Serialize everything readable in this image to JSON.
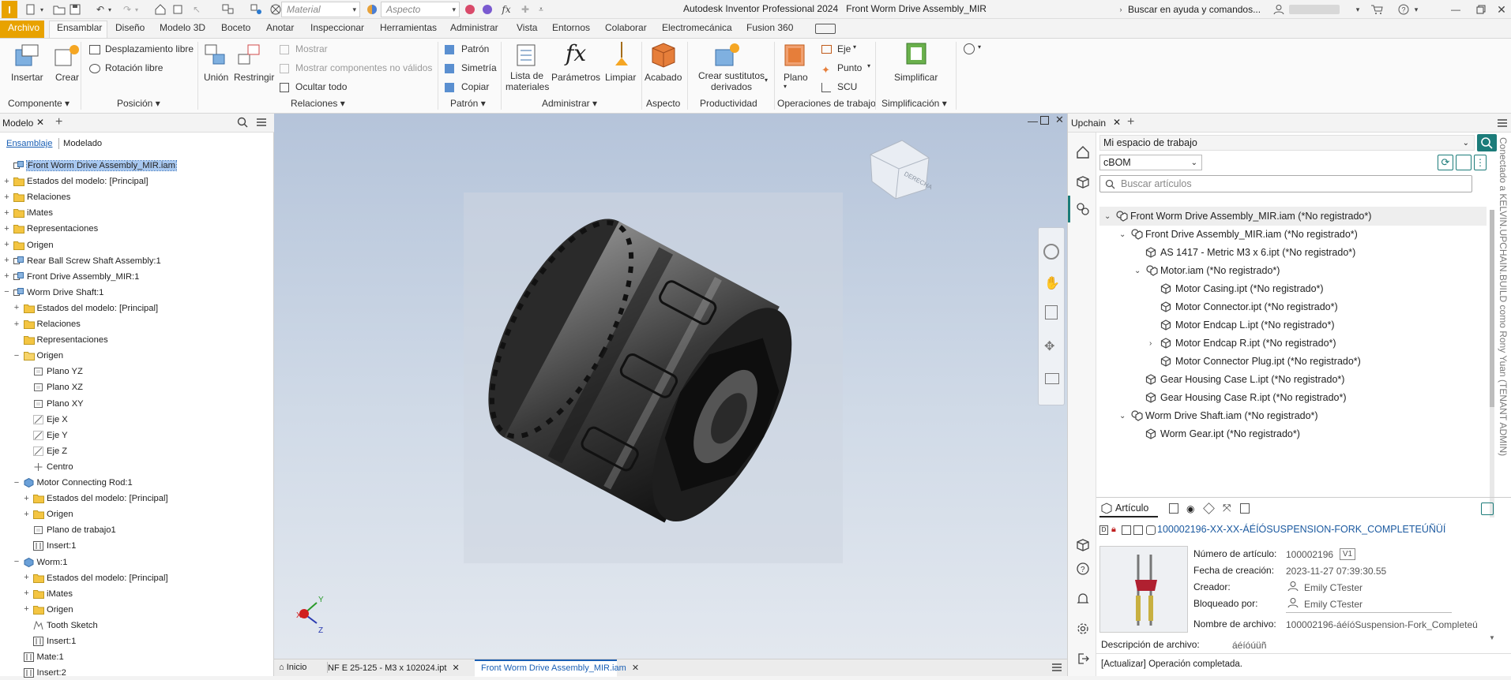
{
  "title_bar": {
    "app_title": "Autodesk Inventor Professional 2024",
    "doc_title": "Front Worm Drive Assembly_MIR",
    "material_placeholder": "Material",
    "appearance_placeholder": "Aspecto",
    "help_search": "Buscar en ayuda y comandos..."
  },
  "ribbon_tabs": [
    "Archivo",
    "Ensamblar",
    "Diseño",
    "Modelo 3D",
    "Boceto",
    "Anotar",
    "Inspeccionar",
    "Herramientas",
    "Administrar",
    "Vista",
    "Entornos",
    "Colaborar",
    "Electromecánica",
    "Fusion 360"
  ],
  "ribbon": {
    "insertar": "Insertar",
    "crear": "Crear",
    "desplazamiento_libre": "Desplazamiento libre",
    "rotacion_libre": "Rotación libre",
    "union": "Unión",
    "restringir": "Restringir",
    "mostrar": "Mostrar",
    "mostrar_no_validos": "Mostrar componentes no válidos",
    "ocultar_todo": "Ocultar todo",
    "patron": "Patrón",
    "simetria": "Simetría",
    "copiar": "Copiar",
    "lista_materiales_1": "Lista de",
    "lista_materiales_2": "materiales",
    "parametros": "Parámetros",
    "limpiar": "Limpiar",
    "acabado": "Acabado",
    "crear_sustitutos_1": "Crear sustitutos",
    "crear_sustitutos_2": "derivados",
    "plano": "Plano",
    "eje": "Eje",
    "punto": "Punto",
    "scu": "SCU",
    "simplificar": "Simplificar",
    "groups": {
      "componente": "Componente",
      "posicion": "Posición",
      "relaciones": "Relaciones",
      "patron": "Patrón",
      "administrar": "Administrar",
      "aspecto": "Aspecto",
      "productividad": "Productividad",
      "operaciones": "Operaciones de trabajo",
      "simplificacion": "Simplificación"
    }
  },
  "browser": {
    "tab_label": "Modelo",
    "sub_tabs": {
      "ensamblaje": "Ensamblaje",
      "modelado": "Modelado"
    },
    "tree": [
      {
        "label": "Front Worm Drive Assembly_MIR.iam",
        "level": 0,
        "icon": "assembly",
        "expander": "",
        "selected": true
      },
      {
        "label": "Estados del modelo: [Principal]",
        "level": 0,
        "icon": "folder",
        "expander": "+"
      },
      {
        "label": "Relaciones",
        "level": 0,
        "icon": "folder",
        "expander": "+"
      },
      {
        "label": "iMates",
        "level": 0,
        "icon": "folder",
        "expander": "+"
      },
      {
        "label": "Representaciones",
        "level": 0,
        "icon": "folder",
        "expander": "+"
      },
      {
        "label": "Origen",
        "level": 0,
        "icon": "folder",
        "expander": "+"
      },
      {
        "label": "Rear Ball Screw Shaft Assembly:1",
        "level": 0,
        "icon": "assembly",
        "expander": "+"
      },
      {
        "label": "Front Drive Assembly_MIR:1",
        "level": 0,
        "icon": "assembly",
        "expander": "+"
      },
      {
        "label": "Worm Drive Shaft:1",
        "level": 0,
        "icon": "assembly",
        "expander": "−"
      },
      {
        "label": "Estados del modelo: [Principal]",
        "level": 1,
        "icon": "folder",
        "expander": "+"
      },
      {
        "label": "Relaciones",
        "level": 1,
        "icon": "folder",
        "expander": "+"
      },
      {
        "label": "Representaciones",
        "level": 1,
        "icon": "folder",
        "expander": ""
      },
      {
        "label": "Origen",
        "level": 1,
        "icon": "folder-open",
        "expander": "−"
      },
      {
        "label": "Plano YZ",
        "level": 2,
        "icon": "plane",
        "expander": ""
      },
      {
        "label": "Plano XZ",
        "level": 2,
        "icon": "plane",
        "expander": ""
      },
      {
        "label": "Plano XY",
        "level": 2,
        "icon": "plane",
        "expander": ""
      },
      {
        "label": "Eje X",
        "level": 2,
        "icon": "axis",
        "expander": ""
      },
      {
        "label": "Eje Y",
        "level": 2,
        "icon": "axis",
        "expander": ""
      },
      {
        "label": "Eje Z",
        "level": 2,
        "icon": "axis",
        "expander": ""
      },
      {
        "label": "Centro",
        "level": 2,
        "icon": "point",
        "expander": ""
      },
      {
        "label": "Motor Connecting Rod:1",
        "level": 1,
        "icon": "part",
        "expander": "−"
      },
      {
        "label": "Estados del modelo: [Principal]",
        "level": 2,
        "icon": "folder",
        "expander": "+"
      },
      {
        "label": "Origen",
        "level": 2,
        "icon": "folder",
        "expander": "+"
      },
      {
        "label": "Plano de trabajo1",
        "level": 2,
        "icon": "plane",
        "expander": ""
      },
      {
        "label": "Insert:1",
        "level": 2,
        "icon": "constraint",
        "expander": ""
      },
      {
        "label": "Worm:1",
        "level": 1,
        "icon": "part",
        "expander": "−"
      },
      {
        "label": "Estados del modelo: [Principal]",
        "level": 2,
        "icon": "folder",
        "expander": "+"
      },
      {
        "label": "iMates",
        "level": 2,
        "icon": "folder",
        "expander": "+"
      },
      {
        "label": "Origen",
        "level": 2,
        "icon": "folder",
        "expander": "+"
      },
      {
        "label": "Tooth Sketch",
        "level": 2,
        "icon": "sketch",
        "expander": ""
      },
      {
        "label": "Insert:1",
        "level": 2,
        "icon": "constraint",
        "expander": ""
      },
      {
        "label": "Mate:1",
        "level": 1,
        "icon": "constraint",
        "expander": ""
      },
      {
        "label": "Insert:2",
        "level": 1,
        "icon": "constraint",
        "expander": ""
      }
    ]
  },
  "viewcube": {
    "face_label": "DERECHA"
  },
  "triad": {
    "x": "X",
    "y": "Y",
    "z": "Z"
  },
  "doc_tabs": {
    "home": "Inicio",
    "tab1": "NF E 25-125 - M3 x 102024.ipt",
    "tab2": "Front Worm Drive Assembly_MIR.iam"
  },
  "upchain": {
    "tab_label": "Upchain",
    "workspace": "Mi espacio de trabajo",
    "view_select": "cBOM",
    "search_placeholder": "Buscar artículos",
    "vertical_status": "Conectado a KELVIN.UPCHAIN.BUILD como Rony Yuan (TENANT ADMIN)",
    "bom": [
      {
        "label": "Front Worm Drive Assembly_MIR.iam (*No registrado*)",
        "level": 0,
        "type": "assembly",
        "expander": "down",
        "highlight": true
      },
      {
        "label": "Front Drive Assembly_MIR.iam (*No registrado*)",
        "level": 1,
        "type": "assembly",
        "expander": "down"
      },
      {
        "label": "AS 1417 - Metric M3 x 6.ipt (*No registrado*)",
        "level": 2,
        "type": "part",
        "expander": ""
      },
      {
        "label": "Motor.iam (*No registrado*)",
        "level": 2,
        "type": "assembly",
        "expander": "down"
      },
      {
        "label": "Motor Casing.ipt (*No registrado*)",
        "level": 3,
        "type": "part",
        "expander": ""
      },
      {
        "label": "Motor Connector.ipt (*No registrado*)",
        "level": 3,
        "type": "part",
        "expander": ""
      },
      {
        "label": "Motor Endcap L.ipt (*No registrado*)",
        "level": 3,
        "type": "part",
        "expander": ""
      },
      {
        "label": "Motor Endcap R.ipt (*No registrado*)",
        "level": 3,
        "type": "part",
        "expander": "right"
      },
      {
        "label": "Motor Connector Plug.ipt (*No registrado*)",
        "level": 3,
        "type": "part",
        "expander": ""
      },
      {
        "label": "Gear Housing Case L.ipt (*No registrado*)",
        "level": 2,
        "type": "part",
        "expander": ""
      },
      {
        "label": "Gear Housing Case R.ipt (*No registrado*)",
        "level": 2,
        "type": "part",
        "expander": ""
      },
      {
        "label": "Worm Drive Shaft.iam (*No registrado*)",
        "level": 1,
        "type": "assembly",
        "expander": "down"
      },
      {
        "label": "Worm Gear.ipt (*No registrado*)",
        "level": 2,
        "type": "part",
        "expander": ""
      }
    ],
    "article_tab": "Artículo",
    "article_name": "100002196-XX-XX-ÁÉÍÓSUSPENSION-FORK_COMPLETEÚÑÜÍ",
    "props": {
      "numero_label": "Número de artículo:",
      "numero_value": "100002196",
      "version": "V1",
      "fecha_label": "Fecha de creación:",
      "fecha_value": "2023-11-27 07:39:30.55",
      "creador_label": "Creador:",
      "creador_value": "Emily CTester",
      "bloqueado_label": "Bloqueado por:",
      "bloqueado_value": "Emily CTester",
      "nombre_label": "Nombre de archivo:",
      "nombre_value": "100002196-áéíóSuspension-Fork_Completeú",
      "descripcion_label": "Descripción de archivo:",
      "descripcion_value": "áéíóúüñ"
    },
    "status": "[Actualizar] Operación completada."
  },
  "colors": {
    "accent": "#e8a200",
    "selection": "#a8c8f0",
    "upchain_teal": "#1c7c7a",
    "link_blue": "#1a5fb4"
  }
}
